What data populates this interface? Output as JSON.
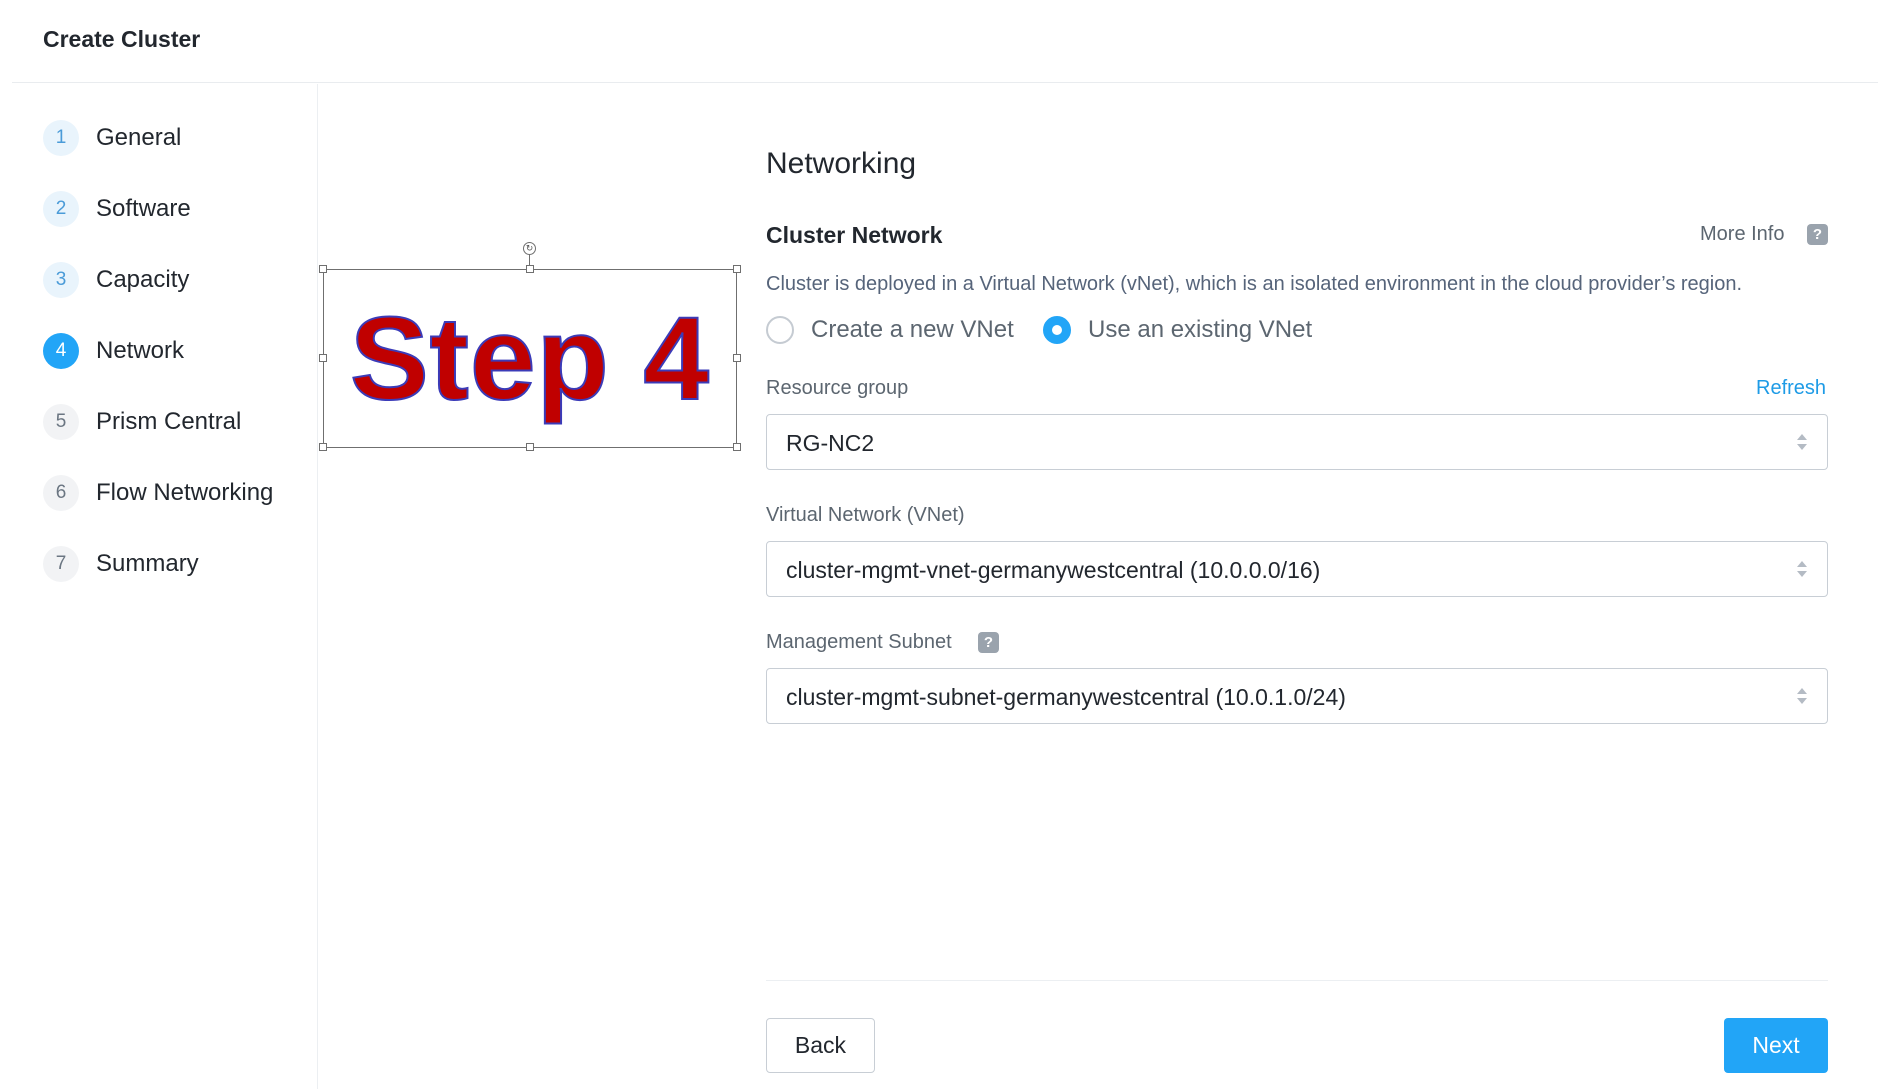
{
  "header": {
    "title": "Create Cluster"
  },
  "steps": [
    {
      "num": "1",
      "label": "General",
      "state": "done"
    },
    {
      "num": "2",
      "label": "Software",
      "state": "done"
    },
    {
      "num": "3",
      "label": "Capacity",
      "state": "done"
    },
    {
      "num": "4",
      "label": "Network",
      "state": "active"
    },
    {
      "num": "5",
      "label": "Prism Central",
      "state": "future"
    },
    {
      "num": "6",
      "label": "Flow Networking",
      "state": "future"
    },
    {
      "num": "7",
      "label": "Summary",
      "state": "future"
    }
  ],
  "annotation": {
    "text": "Step 4"
  },
  "networking": {
    "title": "Networking",
    "cluster_network_title": "Cluster Network",
    "more_info": "More Info",
    "help_glyph": "?",
    "description": "Cluster is deployed in a Virtual Network (vNet), which is an isolated environment in the cloud provider’s region.",
    "radio_new_label": "Create a new VNet",
    "radio_existing_label": "Use an existing VNet",
    "selected_option": "existing"
  },
  "resource_group": {
    "label": "Resource group",
    "refresh": "Refresh",
    "value": "RG-NC2"
  },
  "vnet": {
    "label": "Virtual Network (VNet)",
    "value": "cluster-mgmt-vnet-germanywestcentral (10.0.0.0/16)"
  },
  "subnet": {
    "label": "Management Subnet",
    "value": "cluster-mgmt-subnet-germanywestcentral (10.0.1.0/24)"
  },
  "footer": {
    "back": "Back",
    "next": "Next"
  },
  "colors": {
    "accent": "#22a5f7",
    "annotation_text": "#c00000",
    "annotation_outline": "#3b3bb8"
  }
}
